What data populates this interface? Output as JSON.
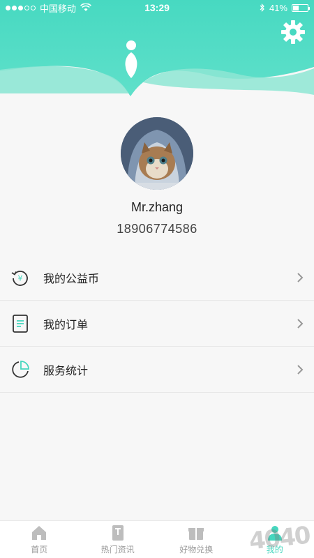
{
  "status_bar": {
    "carrier": "中国移动",
    "time": "13:29",
    "battery": "41%",
    "battery_level": 0.41
  },
  "colors": {
    "accent": "#45d6be",
    "accent_light": "#8ee6d4"
  },
  "header": {
    "settings_icon": "gear-icon"
  },
  "profile": {
    "name": "Mr.zhang",
    "phone": "18906774586"
  },
  "menu": {
    "items": [
      {
        "label": "我的公益币",
        "icon": "coin-refresh-icon"
      },
      {
        "label": "我的订单",
        "icon": "document-icon"
      },
      {
        "label": "服务统计",
        "icon": "pie-chart-icon"
      }
    ]
  },
  "tabbar": {
    "tabs": [
      {
        "label": "首页",
        "icon": "home-icon"
      },
      {
        "label": "热门资讯",
        "icon": "book-icon"
      },
      {
        "label": "好物兑换",
        "icon": "gift-icon"
      },
      {
        "label": "我的",
        "icon": "person-icon"
      }
    ]
  },
  "watermark": "4040"
}
